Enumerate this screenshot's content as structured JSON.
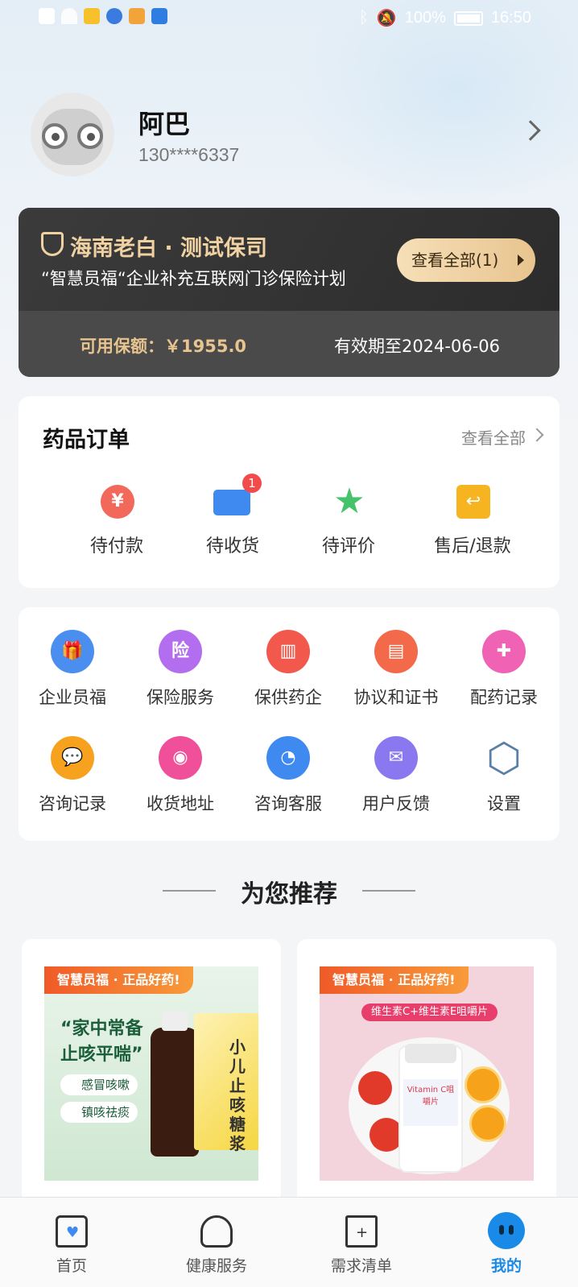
{
  "status_bar": {
    "battery": "100%",
    "time": "16:50"
  },
  "profile": {
    "name": "阿巴",
    "phone": "130****6337"
  },
  "insurance": {
    "company": "海南老白 · 测试保司",
    "plan": "“智慧员福“企业补充互联网门诊保险计划",
    "view_all": "查看全部(1)",
    "available": "可用保额：￥1955.0",
    "expiry": "有效期至2024-06-06"
  },
  "orders": {
    "title": "药品订单",
    "view_all": "查看全部",
    "items": [
      {
        "label": "待付款",
        "icon": "yen-icon",
        "glyph": "¥"
      },
      {
        "label": "待收货",
        "icon": "truck-icon",
        "badge": "1"
      },
      {
        "label": "待评价",
        "icon": "star-icon",
        "glyph": "★"
      },
      {
        "label": "售后/退款",
        "icon": "return-icon",
        "glyph": "↩"
      }
    ]
  },
  "services": [
    {
      "label": "企业员福",
      "icon": "gift-icon",
      "glyph": "🎁",
      "color": "#4a8ff0"
    },
    {
      "label": "保险服务",
      "icon": "insurance-shield-icon",
      "glyph": "险",
      "color": "#b36ef0"
    },
    {
      "label": "保供药企",
      "icon": "building-icon",
      "glyph": "▥",
      "color": "#f2584c"
    },
    {
      "label": "协议和证书",
      "icon": "certificate-icon",
      "glyph": "▤",
      "color": "#f26a4a"
    },
    {
      "label": "配药记录",
      "icon": "medicine-icon",
      "glyph": "✚",
      "color": "#f062b4"
    },
    {
      "label": "咨询记录",
      "icon": "chat-icon",
      "glyph": "💬",
      "color": "#f7a21e"
    },
    {
      "label": "收货地址",
      "icon": "location-icon",
      "glyph": "◉",
      "color": "#f0509a"
    },
    {
      "label": "咨询客服",
      "icon": "headset-icon",
      "glyph": "◔",
      "color": "#3f8af0"
    },
    {
      "label": "用户反馈",
      "icon": "mail-icon",
      "glyph": "✉",
      "color": "#8a78f0"
    },
    {
      "label": "设置",
      "icon": "settings-hex-icon",
      "glyph": "⬡",
      "color": "#5a7fa8"
    }
  ],
  "recommend": {
    "title": "为您推荐"
  },
  "products": [
    {
      "banner": "智慧员福 · 正品好药!",
      "slogan1": "“家中常备",
      "slogan2": "止咳平喘”",
      "bullet1": "感冒咳嗽",
      "bullet2": "镇咳祛痰",
      "box_text": "小儿止咳糖浆"
    },
    {
      "banner": "智慧员福 · 正品好药!",
      "subtitle": "维生素C+维生素E咀嚼片",
      "label": "Vitamin C咀嚼片"
    }
  ],
  "tabs": [
    {
      "label": "首页",
      "icon": "home-heart-icon"
    },
    {
      "label": "健康服务",
      "icon": "health-person-icon"
    },
    {
      "label": "需求清单",
      "icon": "cart-add-icon"
    },
    {
      "label": "我的",
      "icon": "profile-mascot-icon",
      "active": true
    }
  ]
}
